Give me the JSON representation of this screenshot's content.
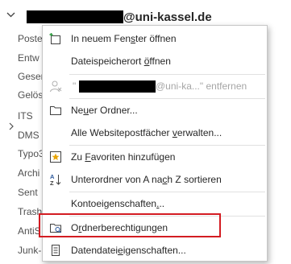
{
  "account": {
    "domain": "@uni-kassel.de"
  },
  "tree": {
    "items": [
      "Poste",
      "Entw",
      "Gesen",
      "Gelös",
      "ITS",
      "DMS",
      "Typo3",
      "Archi",
      "Sent",
      "Trash",
      "AntiS",
      "Junk-"
    ]
  },
  "menu": {
    "items": [
      {
        "pre": "In neuem Fen",
        "acc": "s",
        "post": "ter öffnen",
        "icon": "new-window-icon"
      },
      {
        "pre": "Dateispeicherort ",
        "acc": "ö",
        "post": "ffnen",
        "icon": ""
      },
      {
        "quote_open": "\"",
        "email_visible_part": "@uni-ka...\"",
        "post": " entfernen",
        "icon": "remove-person-icon"
      },
      {
        "pre": "Ne",
        "acc": "u",
        "post": "er Ordner...",
        "icon": "folder-icon"
      },
      {
        "pre": "Alle Websitepostfächer ",
        "acc": "v",
        "post": "erwalten...",
        "icon": ""
      },
      {
        "pre": "Zu ",
        "acc": "F",
        "post": "avoriten hinzufügen",
        "icon": "favorite-star-icon"
      },
      {
        "pre": "Unterordner von A na",
        "acc": "c",
        "post": "h Z sortieren",
        "icon": "sort-az-icon"
      },
      {
        "pre": "Kontoeigenschaften",
        "acc": ".",
        "post": "..",
        "icon": ""
      },
      {
        "pre": "O",
        "acc": "r",
        "post": "dnerberechtigungen",
        "icon": "folder-permissions-icon"
      },
      {
        "pre": "Datendatei",
        "acc": "e",
        "post": "igenschaften...",
        "icon": "data-file-properties-icon"
      }
    ]
  },
  "colors": {
    "highlight_border": "#d31c22",
    "icon_blue": "#2b579a",
    "star": "#e8a400"
  }
}
